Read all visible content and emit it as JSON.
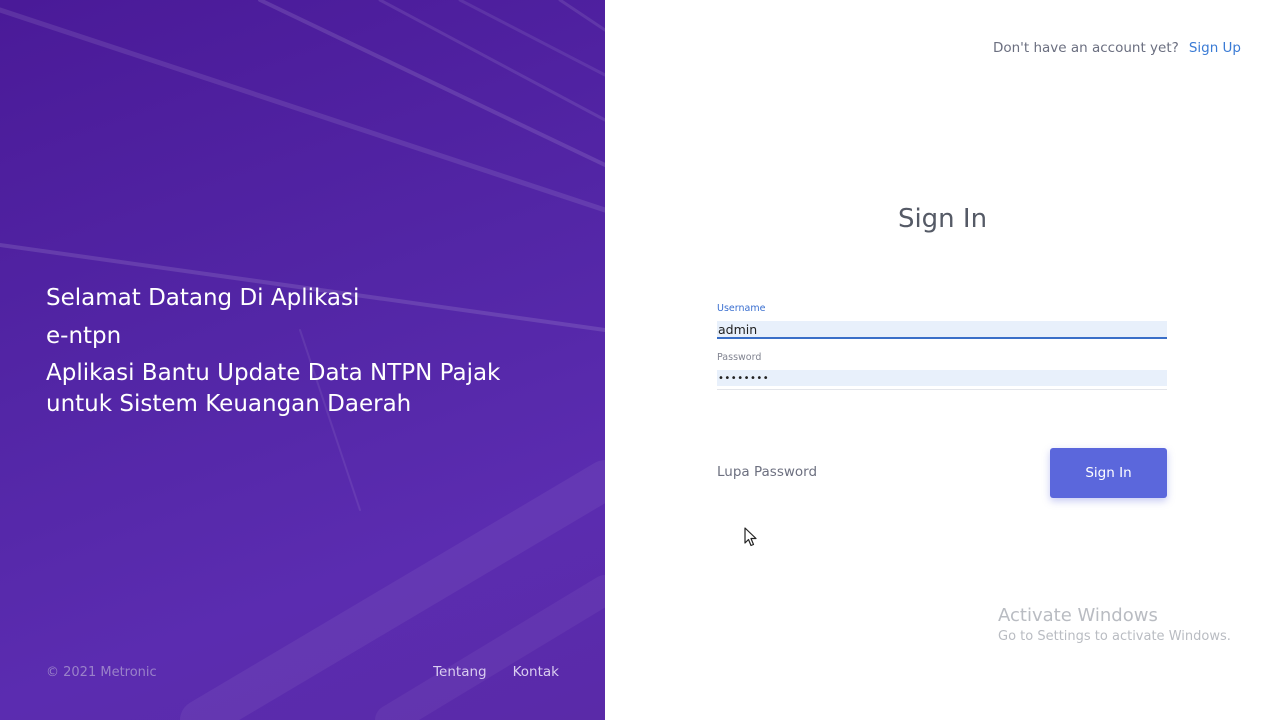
{
  "left_panel": {
    "welcome_line1": "Selamat Datang Di Aplikasi",
    "welcome_line2": "e-ntpn",
    "welcome_line3a": "Aplikasi Bantu Update Data NTPN Pajak",
    "welcome_line3b": "untuk Sistem Keuangan Daerah",
    "copyright": "© 2021 Metronic",
    "footer_links": [
      {
        "label": "Tentang"
      },
      {
        "label": "Kontak"
      }
    ]
  },
  "topbar": {
    "question": "Don't have an account yet?",
    "signup_label": "Sign Up"
  },
  "form": {
    "title": "Sign In",
    "username": {
      "label": "Username",
      "value": "admin"
    },
    "password": {
      "label": "Password",
      "value": "••••••••"
    },
    "forgot_label": "Lupa Password",
    "signin_label": "Sign In"
  },
  "watermark": {
    "line1": "Activate Windows",
    "line2": "Go to Settings to activate Windows."
  },
  "colors": {
    "brand_purple": "#4a1a98",
    "primary_button": "#5b67dc",
    "link_blue": "#3a7bd5"
  },
  "icons": {
    "cursor": "mouse-pointer-icon"
  }
}
